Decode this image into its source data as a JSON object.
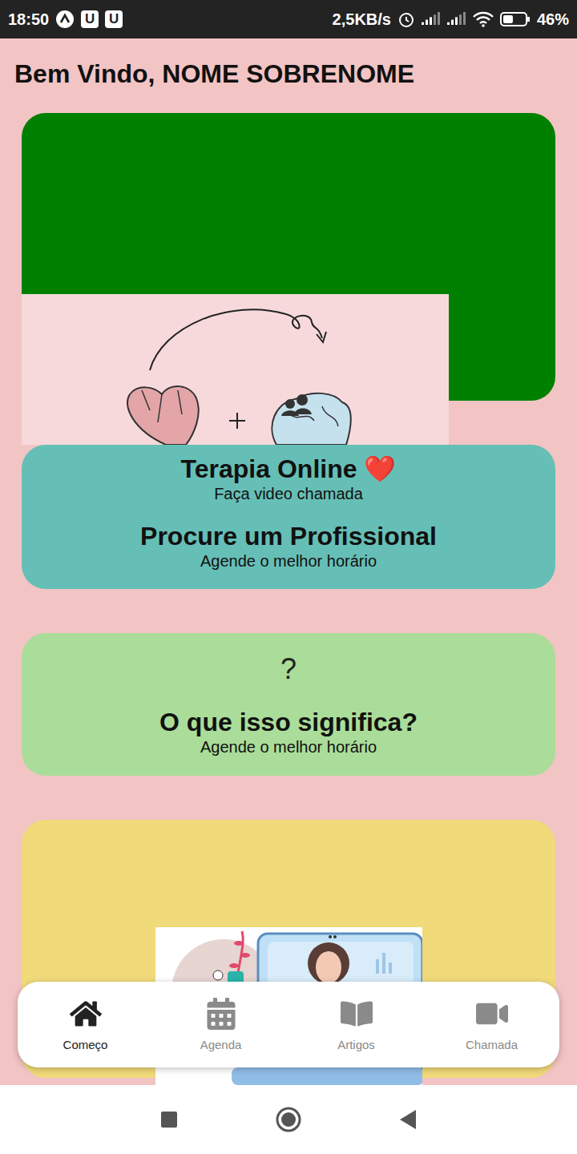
{
  "status_bar": {
    "time": "18:50",
    "badges": [
      "U",
      "U"
    ],
    "speed": "2,5KB/s",
    "battery": "46%",
    "battery_level": 0.46
  },
  "greeting": "Bem Vindo, NOME SOBRENOME",
  "action_card": {
    "items": [
      {
        "title": "Terapia Online ❤️",
        "subtitle": "Faça video chamada"
      },
      {
        "title": "Procure um Profissional",
        "subtitle": "Agende o melhor horário"
      }
    ]
  },
  "info_card": {
    "symbol": "?",
    "title": "O que isso significa?",
    "subtitle": "Agende o melhor horário"
  },
  "tab_bar": {
    "items": [
      {
        "label": "Começo",
        "icon": "home",
        "selected": true
      },
      {
        "label": "Agenda",
        "icon": "calendar",
        "selected": false
      },
      {
        "label": "Artigos",
        "icon": "book",
        "selected": false
      },
      {
        "label": "Chamada",
        "icon": "video",
        "selected": false
      }
    ]
  }
}
